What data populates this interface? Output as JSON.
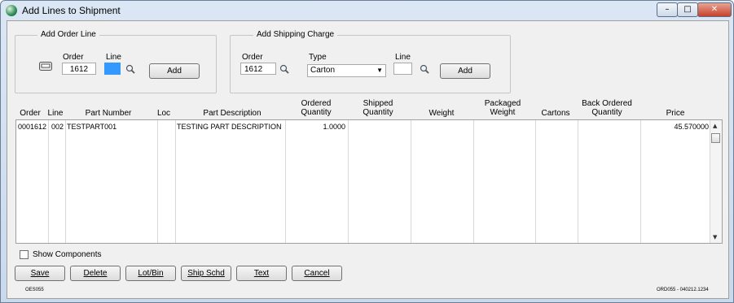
{
  "window": {
    "title": "Add Lines to Shipment",
    "min_glyph": "–",
    "max_glyph": "□",
    "close_glyph": "✕"
  },
  "order_line": {
    "group_title": "Add Order Line",
    "order_label": "Order",
    "order_value": "1612",
    "line_label": "Line",
    "line_value": "",
    "add_label": "Add"
  },
  "shipping_charge": {
    "group_title": "Add Shipping Charge",
    "order_label": "Order",
    "order_value": "1612",
    "type_label": "Type",
    "type_value": "Carton",
    "line_label": "Line",
    "line_value": "",
    "add_label": "Add"
  },
  "grid": {
    "headers": {
      "order": "Order",
      "line": "Line",
      "part_number": "Part Number",
      "loc": "Loc",
      "part_description": "Part Description",
      "ordered_qty_1": "Ordered",
      "ordered_qty_2": "Quantity",
      "shipped_qty_1": "Shipped",
      "shipped_qty_2": "Quantity",
      "weight": "Weight",
      "packaged_weight_1": "Packaged",
      "packaged_weight_2": "Weight",
      "cartons": "Cartons",
      "back_ordered_1": "Back Ordered",
      "back_ordered_2": "Quantity",
      "price": "Price"
    },
    "rows": [
      {
        "order": "0001612",
        "line": "002",
        "part_number": "TESTPART001",
        "loc": "",
        "part_description": "TESTING PART DESCRIPTION",
        "ordered_qty": "1.0000",
        "shipped_qty": "",
        "weight": "",
        "packaged_weight": "",
        "cartons": "",
        "back_ordered_qty": "",
        "price": "45.570000"
      }
    ]
  },
  "show_components_label": "Show Components",
  "buttons": {
    "save": "Save",
    "delete": "Delete",
    "lot_bin": "Lot/Bin",
    "ship_schd": "Ship Schd",
    "text": "Text",
    "cancel": "Cancel"
  },
  "footer": {
    "left": "OES055",
    "right": "ORD055 - 040212.1234"
  },
  "icons": {
    "app": "app-globe-icon",
    "lookup": "magnifier-icon",
    "scanner": "scanner-icon"
  },
  "colors": {
    "selection": "#3399ff",
    "title_bg": "#dbe7f5",
    "close_button": "#c7412b"
  }
}
